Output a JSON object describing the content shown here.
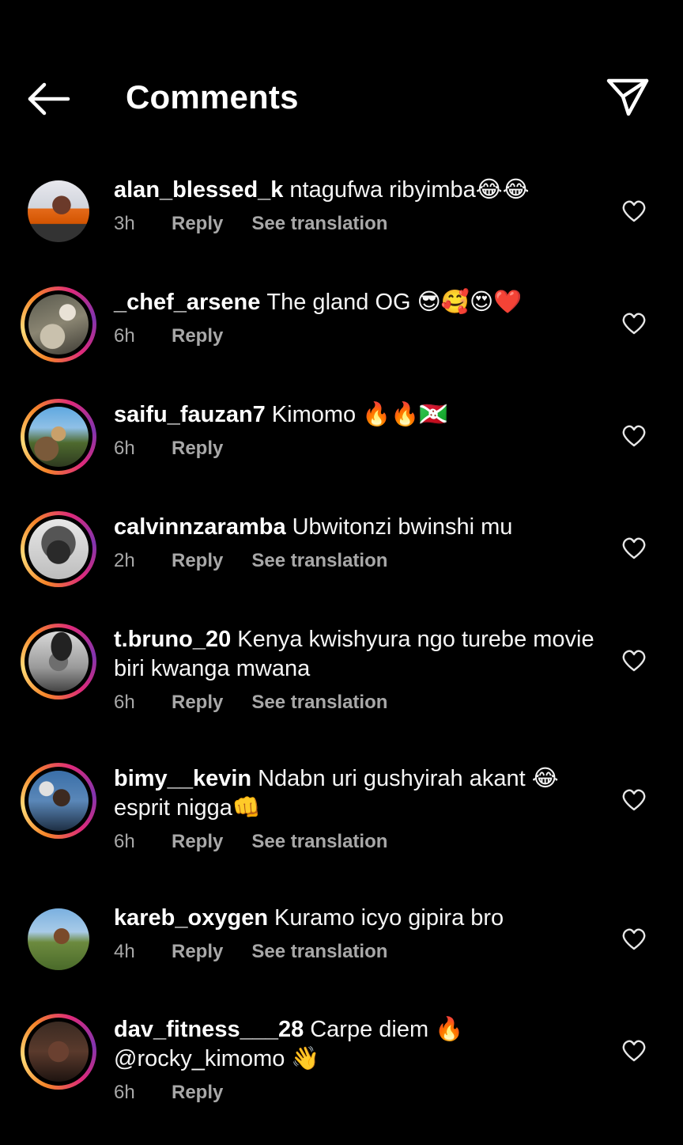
{
  "header": {
    "title": "Comments",
    "back_icon": "arrow-left-icon",
    "share_icon": "paper-plane-icon"
  },
  "colors": {
    "background": "#000000",
    "text": "#f5f5f5",
    "secondary_text": "#a8a8a8",
    "story_ring": [
      "#f58529",
      "#feda77",
      "#dd2a7b",
      "#8134af"
    ]
  },
  "labels": {
    "reply": "Reply",
    "see_translation": "See translation"
  },
  "comments": [
    {
      "username": "alan_blessed_k",
      "text": "ntagufwa ribyimba😂😂",
      "time": "3h",
      "translate": true,
      "story_ring": false
    },
    {
      "username": "_chef_arsene",
      "text": "The gland OG 😎🥰😍❤️",
      "time": "6h",
      "translate": false,
      "story_ring": true
    },
    {
      "username": "saifu_fauzan7",
      "text": "Kimomo 🔥🔥🇧🇮",
      "time": "6h",
      "translate": false,
      "story_ring": true
    },
    {
      "username": "calvinnzaramba",
      "text": "Ubwitonzi bwinshi mu",
      "time": "2h",
      "translate": true,
      "story_ring": true
    },
    {
      "username": "t.bruno_20",
      "text": "Kenya kwishyura ngo turebe movie biri kwanga mwana",
      "time": "6h",
      "translate": true,
      "story_ring": true
    },
    {
      "username": "bimy__kevin",
      "text": "Ndabn uri gushyirah akant 😂 esprit nigga👊",
      "time": "6h",
      "translate": true,
      "story_ring": true
    },
    {
      "username": "kareb_oxygen",
      "text": "Kuramo icyo gipira bro",
      "time": "4h",
      "translate": true,
      "story_ring": false
    },
    {
      "username": "dav_fitness___28",
      "text": "Carpe diem 🔥 @rocky_kimomo 👋",
      "time": "6h",
      "translate": false,
      "story_ring": true
    }
  ]
}
